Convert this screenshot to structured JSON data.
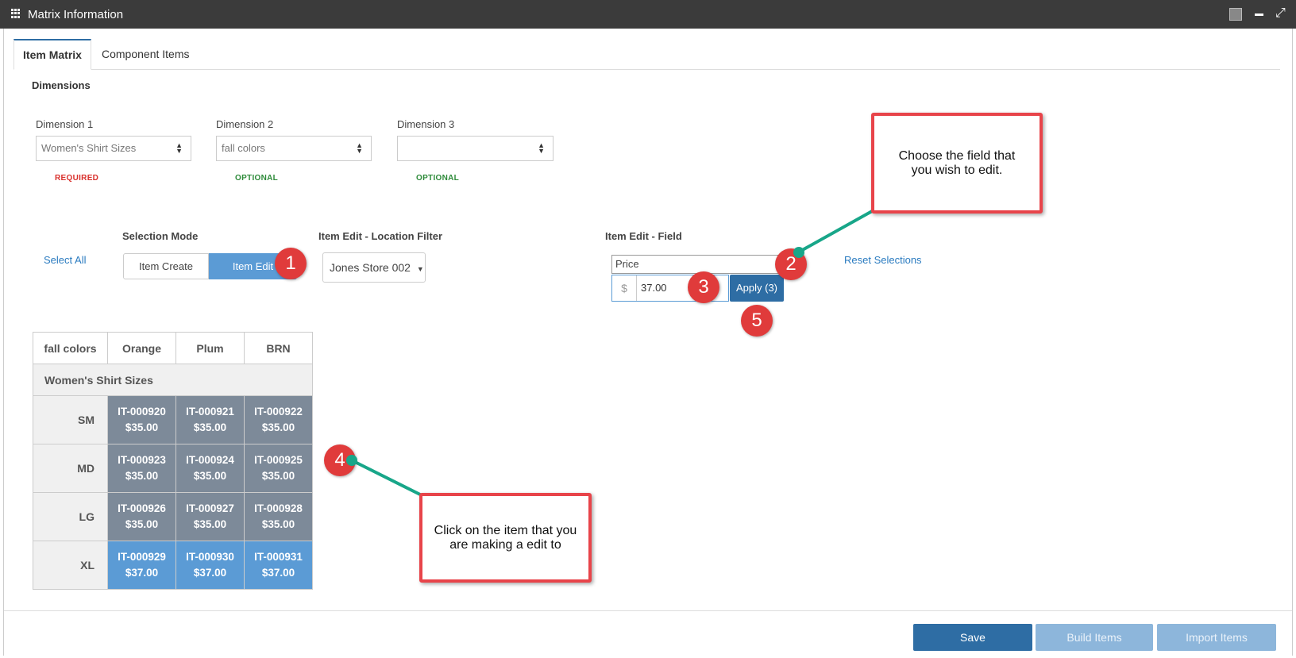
{
  "window": {
    "title": "Matrix Information",
    "expand_glyph": "⤢"
  },
  "tabs": [
    {
      "label": "Item Matrix",
      "active": true
    },
    {
      "label": "Component Items",
      "active": false
    }
  ],
  "dimensions": {
    "heading": "Dimensions",
    "items": [
      {
        "label": "Dimension 1",
        "value": "Women's Shirt Sizes",
        "status": "REQUIRED"
      },
      {
        "label": "Dimension 2",
        "value": "fall colors",
        "status": "OPTIONAL"
      },
      {
        "label": "Dimension 3",
        "value": "",
        "status": "OPTIONAL"
      }
    ]
  },
  "select_all": "Select All",
  "selection_mode": {
    "label": "Selection Mode",
    "options": [
      "Item Create",
      "Item Edit"
    ],
    "selected": "Item Edit"
  },
  "location_filter": {
    "label": "Item Edit - Location Filter",
    "value": "Jones Store 002"
  },
  "item_edit_field": {
    "label": "Item Edit - Field",
    "value": "Price",
    "currency_symbol": "$",
    "amount": "37.00",
    "apply_label": "Apply (3)"
  },
  "reset_selections": "Reset Selections",
  "matrix": {
    "corner": "fall colors",
    "columns": [
      "Orange",
      "Plum",
      "BRN"
    ],
    "group_label": "Women's Shirt Sizes",
    "rows": [
      {
        "size": "SM",
        "cells": [
          {
            "id": "IT-000920",
            "price": "$35.00",
            "selected": false
          },
          {
            "id": "IT-000921",
            "price": "$35.00",
            "selected": false
          },
          {
            "id": "IT-000922",
            "price": "$35.00",
            "selected": false
          }
        ]
      },
      {
        "size": "MD",
        "cells": [
          {
            "id": "IT-000923",
            "price": "$35.00",
            "selected": false
          },
          {
            "id": "IT-000924",
            "price": "$35.00",
            "selected": false
          },
          {
            "id": "IT-000925",
            "price": "$35.00",
            "selected": false
          }
        ]
      },
      {
        "size": "LG",
        "cells": [
          {
            "id": "IT-000926",
            "price": "$35.00",
            "selected": false
          },
          {
            "id": "IT-000927",
            "price": "$35.00",
            "selected": false
          },
          {
            "id": "IT-000928",
            "price": "$35.00",
            "selected": false
          }
        ]
      },
      {
        "size": "XL",
        "cells": [
          {
            "id": "IT-000929",
            "price": "$37.00",
            "selected": true
          },
          {
            "id": "IT-000930",
            "price": "$37.00",
            "selected": true
          },
          {
            "id": "IT-000931",
            "price": "$37.00",
            "selected": true
          }
        ]
      }
    ]
  },
  "footer": {
    "save": "Save",
    "build": "Build Items",
    "import": "Import Items"
  },
  "annotations": {
    "badges": [
      "1",
      "2",
      "3",
      "4",
      "5"
    ],
    "callout_field": "Choose the field that you wish to edit.",
    "callout_item": "Click on the item that you are making a edit to"
  },
  "colors": {
    "primary": "#2e6da4",
    "selected_cell": "#5b9bd5",
    "cell": "#7d8a99",
    "annotation_red": "#e8444a",
    "annotation_green": "#18a689",
    "required": "#d9302c",
    "optional": "#2e8b3a"
  }
}
